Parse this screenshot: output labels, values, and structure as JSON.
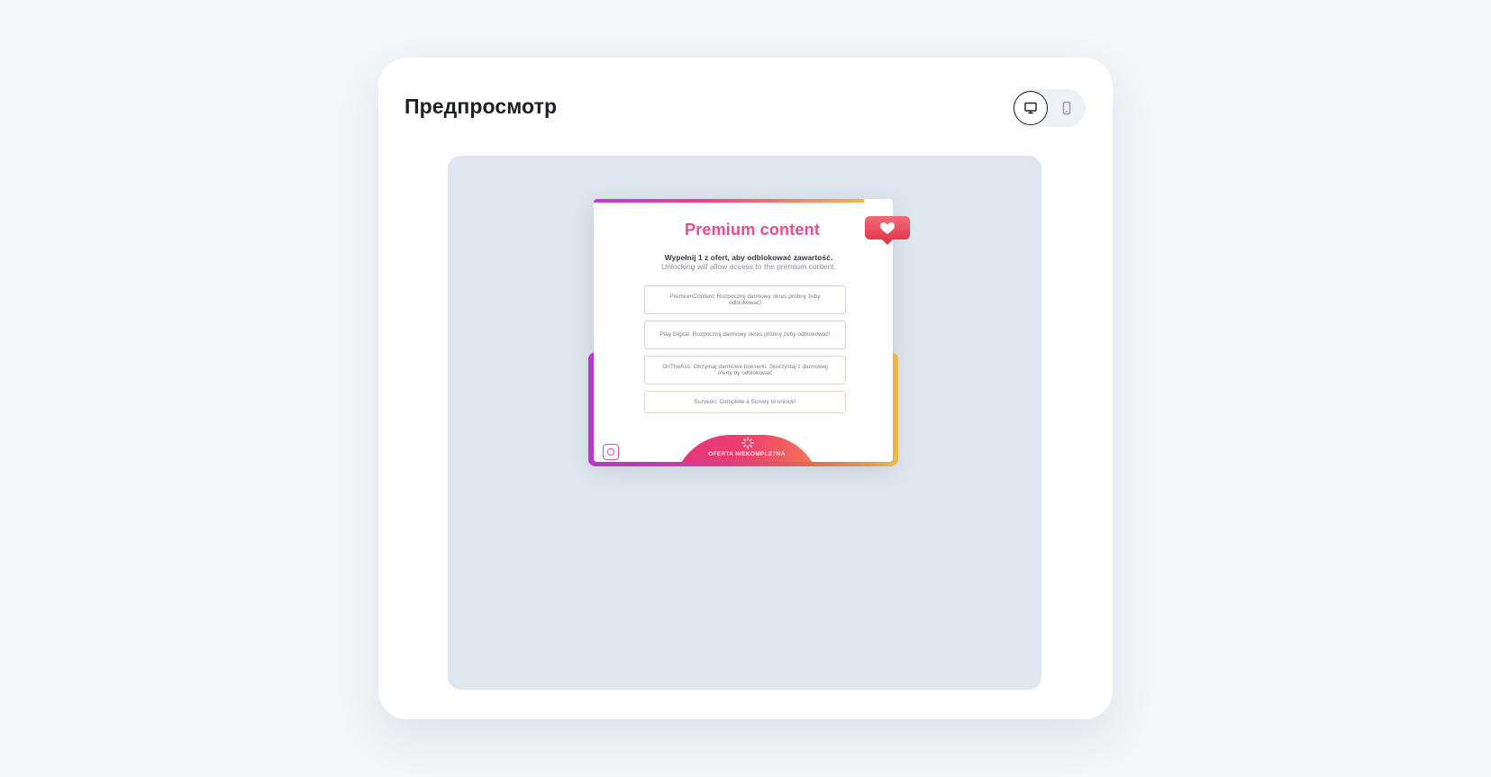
{
  "header": {
    "title": "Предпросмотр"
  },
  "device_toggle": {
    "selected": "desktop",
    "options": [
      {
        "id": "desktop",
        "icon": "monitor-icon"
      },
      {
        "id": "mobile",
        "icon": "smartphone-icon"
      }
    ]
  },
  "popup": {
    "title": "Premium content",
    "subtitle_bold": "Wypełnij 1 z ofert, aby odblokować zawartość.",
    "subtitle": "Unlocking will allow access to the premium content.",
    "offers": [
      {
        "label": "PremiumContent: Rozpocznij darmowy okres próbny żeby odblokować!"
      },
      {
        "label": "Play Digital: Rozpocznij darmowy okres próbny żeby odblokować!"
      },
      {
        "label": "OnTheAss: Otrzymaj darmowe bokserki. Skorzystaj z darmowej oferty by odblokować"
      },
      {
        "label": "Surveoo: Complete a Survey to unlock!"
      }
    ],
    "unlock_status": "OFERTA NIEKOMPLETNA",
    "badge_icon": "heart-icon",
    "logo_icon": "instagram-icon",
    "status_icon": "spinner-icon"
  },
  "colors": {
    "accent_pink": "#e94d8a",
    "gradient_start": "#c13ad7",
    "gradient_end": "#f6c24a",
    "badge_red": "#ee4a5c",
    "preview_bg": "#dfe6ee"
  }
}
